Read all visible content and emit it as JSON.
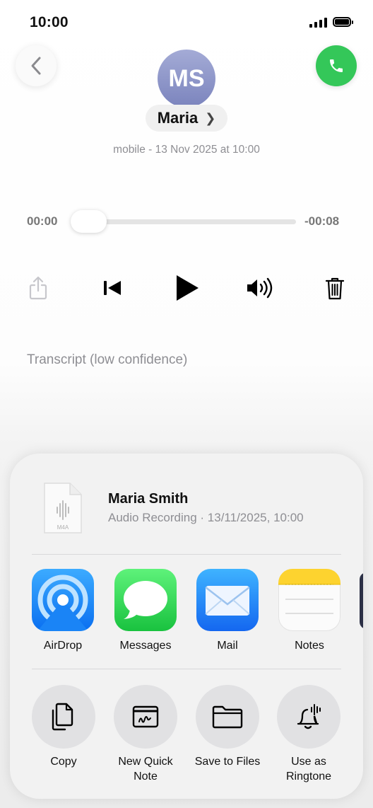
{
  "status_bar": {
    "time": "10:00"
  },
  "header": {
    "avatar_initials": "MS",
    "contact_name": "Maria",
    "chevron": "❯",
    "meta": "mobile - 13 Nov 2025 at 10:00"
  },
  "player": {
    "elapsed": "00:00",
    "remaining": "-00:08",
    "progress": 0
  },
  "transcript_label": "Transcript (low confidence)",
  "share_sheet": {
    "file": {
      "title": "Maria  Smith",
      "subtitle": "Audio Recording · 13/11/2025, 10:00",
      "type_label": "M4A"
    },
    "apps": [
      {
        "label": "AirDrop",
        "icon": "airdrop-icon"
      },
      {
        "label": "Messages",
        "icon": "messages-icon"
      },
      {
        "label": "Mail",
        "icon": "mail-icon"
      },
      {
        "label": "Notes",
        "icon": "notes-icon"
      }
    ],
    "actions": [
      {
        "label": "Copy",
        "icon": "copy-icon"
      },
      {
        "label": "New Quick Note",
        "icon": "quick-note-icon"
      },
      {
        "label": "Save to Files",
        "icon": "folder-icon"
      },
      {
        "label": "Use as Ringtone",
        "icon": "bell-waveform-icon"
      }
    ]
  },
  "colors": {
    "call_green": "#34c759",
    "secondary_text": "#8e8e93",
    "sheet_bg": "#f2f2f2"
  }
}
